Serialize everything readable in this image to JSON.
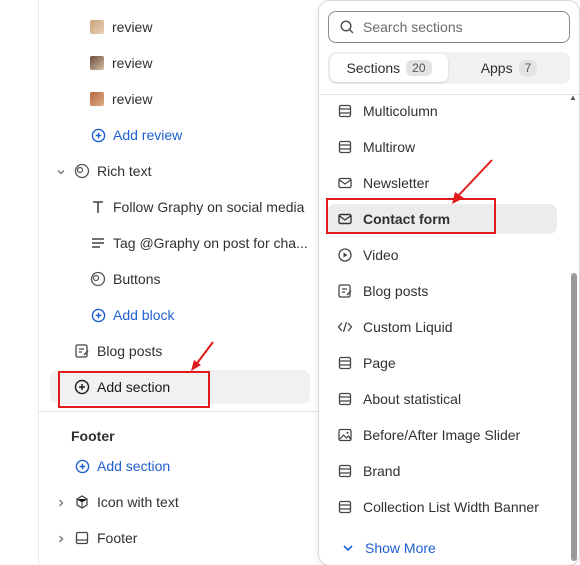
{
  "tree": {
    "items": [
      {
        "label": "review",
        "icon": "review-thumbnail",
        "kind": "child"
      },
      {
        "label": "review",
        "icon": "review-thumbnail",
        "kind": "child"
      },
      {
        "label": "review",
        "icon": "review-thumbnail",
        "kind": "child"
      },
      {
        "label": "Add review",
        "icon": "plus-circle-icon",
        "kind": "link"
      },
      {
        "label": "Rich text",
        "icon": "rich-text-icon",
        "kind": "section"
      },
      {
        "label": "Follow Graphy on social media",
        "icon": "text-icon",
        "kind": "child"
      },
      {
        "label": "Tag @Graphy on post for cha...",
        "icon": "paragraph-icon",
        "kind": "child"
      },
      {
        "label": "Buttons",
        "icon": "button-icon",
        "kind": "child"
      },
      {
        "label": "Add block",
        "icon": "plus-circle-icon",
        "kind": "link"
      },
      {
        "label": "Blog posts",
        "icon": "blog-icon",
        "kind": "section"
      },
      {
        "label": "Add section",
        "icon": "plus-circle-icon",
        "kind": "action"
      }
    ],
    "footer": {
      "heading": "Footer",
      "add_label": "Add section",
      "items": [
        {
          "label": "Icon with text",
          "icon": "box-icon"
        },
        {
          "label": "Footer",
          "icon": "layout-icon"
        }
      ]
    }
  },
  "picker": {
    "search_placeholder": "Search sections",
    "tabs": [
      {
        "label": "Sections",
        "count": "20",
        "active": true
      },
      {
        "label": "Apps",
        "count": "7",
        "active": false
      }
    ],
    "items": [
      {
        "label": "Multicolumn",
        "icon": "columns-icon"
      },
      {
        "label": "Multirow",
        "icon": "rows-icon"
      },
      {
        "label": "Newsletter",
        "icon": "envelope-icon"
      },
      {
        "label": "Contact form",
        "icon": "envelope-icon",
        "selected": true
      },
      {
        "label": "Video",
        "icon": "play-icon"
      },
      {
        "label": "Blog posts",
        "icon": "blog-icon"
      },
      {
        "label": "Custom Liquid",
        "icon": "code-icon"
      },
      {
        "label": "Page",
        "icon": "layout-icon"
      },
      {
        "label": "About statistical",
        "icon": "layout-icon"
      },
      {
        "label": "Before/After Image Slider",
        "icon": "image-icon"
      },
      {
        "label": "Brand",
        "icon": "layout-icon"
      },
      {
        "label": "Collection List Width Banner",
        "icon": "layout-icon"
      }
    ],
    "show_more": "Show More"
  },
  "annotation": {
    "color": "#e01b1b"
  },
  "colors": {
    "link": "#1f5fd1",
    "selected_bg": "#ececec"
  }
}
